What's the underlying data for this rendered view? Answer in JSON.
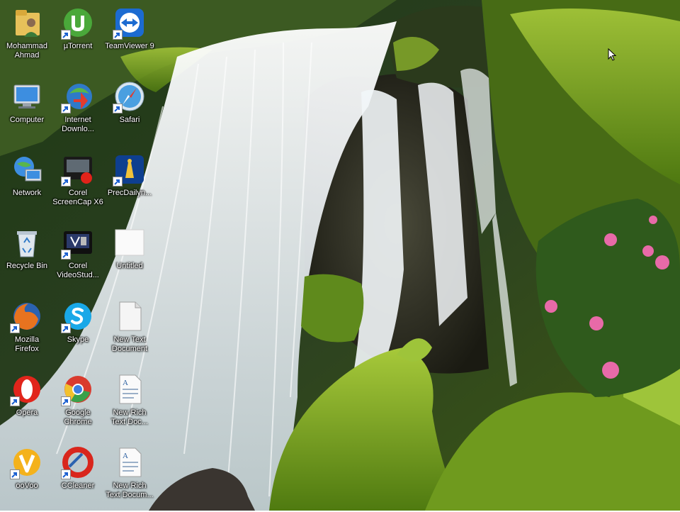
{
  "desktop": {
    "icons": [
      {
        "label": "Mohammad\nAhmad",
        "icon": "user-folder-icon",
        "shortcut": false
      },
      {
        "label": "µTorrent",
        "icon": "utorrent-icon",
        "shortcut": true
      },
      {
        "label": "TeamViewer 9",
        "icon": "teamviewer-icon",
        "shortcut": true
      },
      {
        "label": "Computer",
        "icon": "computer-icon",
        "shortcut": false
      },
      {
        "label": "Internet\nDownlo...",
        "icon": "internet-download-manager-icon",
        "shortcut": true
      },
      {
        "label": "Safari",
        "icon": "safari-icon",
        "shortcut": true
      },
      {
        "label": "Network",
        "icon": "network-icon",
        "shortcut": false
      },
      {
        "label": "Corel\nScreenCap X6",
        "icon": "corel-screencap-icon",
        "shortcut": true
      },
      {
        "label": "PrecDailyn...",
        "icon": "prec-daily-icon",
        "shortcut": true
      },
      {
        "label": "Recycle Bin",
        "icon": "recycle-bin-icon",
        "shortcut": false
      },
      {
        "label": "Corel\nVideoStud...",
        "icon": "corel-videostudio-icon",
        "shortcut": true
      },
      {
        "label": "Untitled",
        "icon": "blank-file-icon",
        "shortcut": false
      },
      {
        "label": "Mozilla\nFirefox",
        "icon": "firefox-icon",
        "shortcut": true
      },
      {
        "label": "Skype",
        "icon": "skype-icon",
        "shortcut": true
      },
      {
        "label": "New Text\nDocument",
        "icon": "text-document-icon",
        "shortcut": false
      },
      {
        "label": "Opera",
        "icon": "opera-icon",
        "shortcut": true
      },
      {
        "label": "Google\nChrome",
        "icon": "chrome-icon",
        "shortcut": true
      },
      {
        "label": "New Rich\nText Doc...",
        "icon": "rich-text-document-icon",
        "shortcut": false
      },
      {
        "label": "ooVoo",
        "icon": "oovoo-icon",
        "shortcut": true
      },
      {
        "label": "CCleaner",
        "icon": "ccleaner-icon",
        "shortcut": true
      },
      {
        "label": "New Rich\nText Docum...",
        "icon": "rich-text-document-icon",
        "shortcut": false
      }
    ]
  },
  "colors": {
    "label_text": "#ffffff",
    "moss": "#6f9a1e",
    "water": "#eef3f6",
    "flowers": "#e86aa8"
  }
}
